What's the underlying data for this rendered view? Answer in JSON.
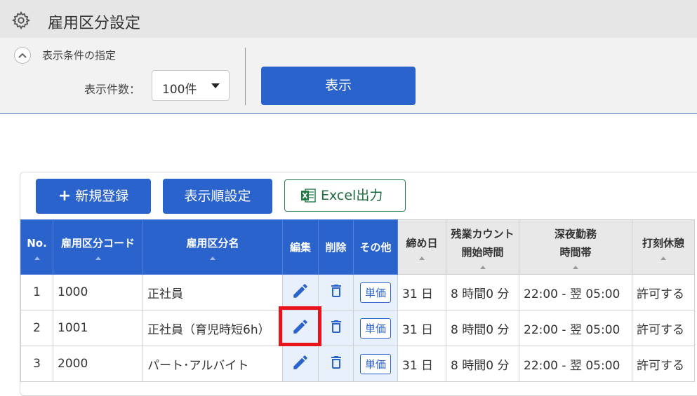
{
  "header": {
    "title": "雇用区分設定",
    "icon": "gear-icon"
  },
  "conditions": {
    "label": "表示条件の指定",
    "count_label": "表示件数：",
    "count_value": "100件",
    "show_button": "表示"
  },
  "toolbar": {
    "new_label": "新規登録",
    "order_label": "表示順設定",
    "excel_label": "Excel出力"
  },
  "table": {
    "headers": {
      "no": "No.",
      "code": "雇用区分コード",
      "name": "雇用区分名",
      "edit": "編集",
      "delete": "削除",
      "other": "その他",
      "cutoff": "締め日",
      "overtime_l1": "残業カウント",
      "overtime_l2": "開始時間",
      "night_l1": "深夜勤務",
      "night_l2": "時間帯",
      "break": "打刻休憩"
    },
    "tanka_label": "単価",
    "rows": [
      {
        "no": "1",
        "code": "1000",
        "name": "正社員",
        "cutoff": "31 日",
        "overtime": "8 時間0 分",
        "night": "22:00 - 翌 05:00",
        "break": "許可する"
      },
      {
        "no": "2",
        "code": "1001",
        "name": "正社員（育児時短6h）",
        "cutoff": "31 日",
        "overtime": "8 時間0 分",
        "night": "22:00 - 翌 05:00",
        "break": "許可する"
      },
      {
        "no": "3",
        "code": "2000",
        "name": "パート･アルバイト",
        "cutoff": "31 日",
        "overtime": "8 時間0 分",
        "night": "22:00 - 翌 05:00",
        "break": "許可する"
      }
    ]
  },
  "colors": {
    "accent": "#2b63cc",
    "highlight": "#e8141b",
    "excel": "#1f6b3f"
  }
}
